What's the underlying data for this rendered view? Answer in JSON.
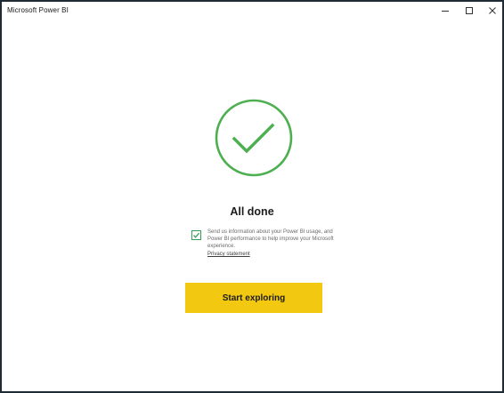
{
  "window": {
    "title": "Microsoft Power BI"
  },
  "main": {
    "heading": "All done",
    "consent": {
      "checked": true,
      "text": "Send us information about your Power BI usage, and Power BI performance to help improve your Microsoft experience.",
      "privacy_link": "Privacy statement"
    },
    "start_button": "Start exploring"
  },
  "colors": {
    "accent_green": "#4caf50",
    "button_yellow": "#f2c811",
    "checkbox_green": "#3a9a56"
  },
  "icons": {
    "minimize": "minimize-icon",
    "maximize": "maximize-icon",
    "close": "close-icon",
    "success": "check-circle-icon",
    "checkbox": "checkmark-icon"
  }
}
